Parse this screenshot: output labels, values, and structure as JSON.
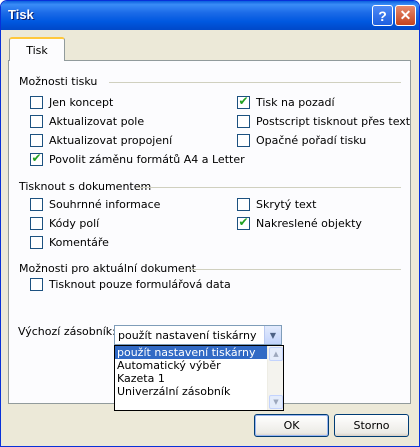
{
  "window": {
    "title": "Tisk",
    "help_glyph": "?",
    "close_glyph": "✕"
  },
  "tabs": [
    {
      "label": "Tisk",
      "active": true
    }
  ],
  "groups": {
    "print_options": {
      "title": "Možnosti tisku",
      "items": [
        {
          "label": "Jen koncept",
          "checked": false
        },
        {
          "label": "Aktualizovat pole",
          "checked": false
        },
        {
          "label": "Aktualizovat propojení",
          "checked": false
        },
        {
          "label": "Povolit záměnu formátů A4 a Letter",
          "checked": true
        },
        {
          "label": "Tisk na pozadí",
          "checked": true
        },
        {
          "label": "Postscript tisknout přes text",
          "checked": false
        },
        {
          "label": "Opačné pořadí tisku",
          "checked": false
        }
      ]
    },
    "print_with_document": {
      "title": "Tisknout s dokumentem",
      "items": [
        {
          "label": "Souhrnné informace",
          "checked": false
        },
        {
          "label": "Kódy polí",
          "checked": false
        },
        {
          "label": "Komentáře",
          "checked": false
        },
        {
          "label": "Skrytý text",
          "checked": false
        },
        {
          "label": "Nakreslené objekty",
          "checked": true
        }
      ]
    },
    "current_document": {
      "title": "Možnosti pro aktuální dokument",
      "items": [
        {
          "label": "Tisknout pouze formulářová data",
          "checked": false
        }
      ]
    }
  },
  "default_tray": {
    "label": "Výchozí zásobník:",
    "value": "použít nastavení tiskárny",
    "options": [
      "použít nastavení tiskárny",
      "Automatický výběr",
      "Kazeta 1",
      "Univerzální zásobník"
    ],
    "selected_index": 0
  },
  "buttons": {
    "ok": "OK",
    "cancel": "Storno"
  },
  "colors": {
    "titlebar": "#0058e0",
    "checkmark": "#21a121",
    "selection": "#316ac5"
  }
}
